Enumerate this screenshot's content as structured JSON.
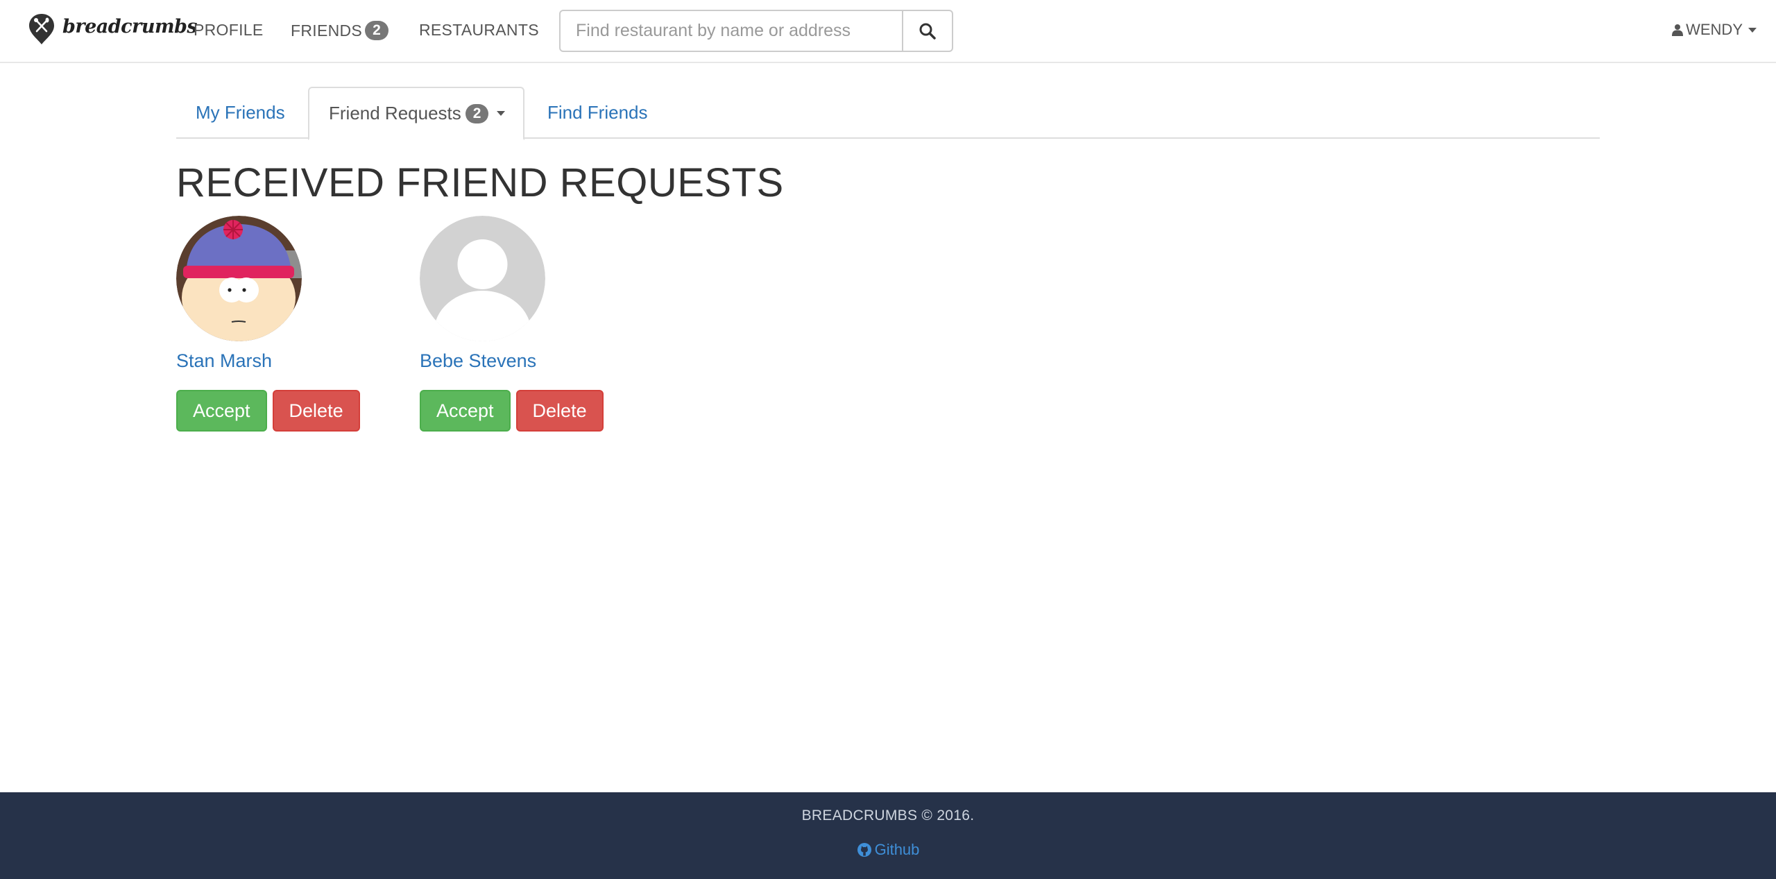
{
  "navbar": {
    "brand": "breadcrumbs",
    "links": {
      "profile": "PROFILE",
      "friends": "FRIENDS",
      "friends_badge": "2",
      "restaurants": "RESTAURANTS"
    },
    "search": {
      "placeholder": "Find restaurant by name or address",
      "icon": "search-icon"
    },
    "user": "WENDY"
  },
  "tabs": {
    "my_friends": "My Friends",
    "friend_requests": "Friend Requests",
    "friend_requests_badge": "2",
    "find_friends": "Find Friends",
    "active": "friend_requests"
  },
  "page_title": "RECEIVED FRIEND REQUESTS",
  "requests": [
    {
      "name": "Stan Marsh",
      "avatar": "cartoon-avatar",
      "accept": "Accept",
      "delete": "Delete"
    },
    {
      "name": "Bebe Stevens",
      "avatar": "default-avatar",
      "accept": "Accept",
      "delete": "Delete"
    }
  ],
  "footer": {
    "copyright": "BREADCRUMBS © 2016.",
    "github": "Github"
  },
  "colors": {
    "link": "#2a73b8",
    "accept": "#5cb85c",
    "delete": "#d9534f",
    "footer_bg": "#263249",
    "badge": "#777777"
  }
}
